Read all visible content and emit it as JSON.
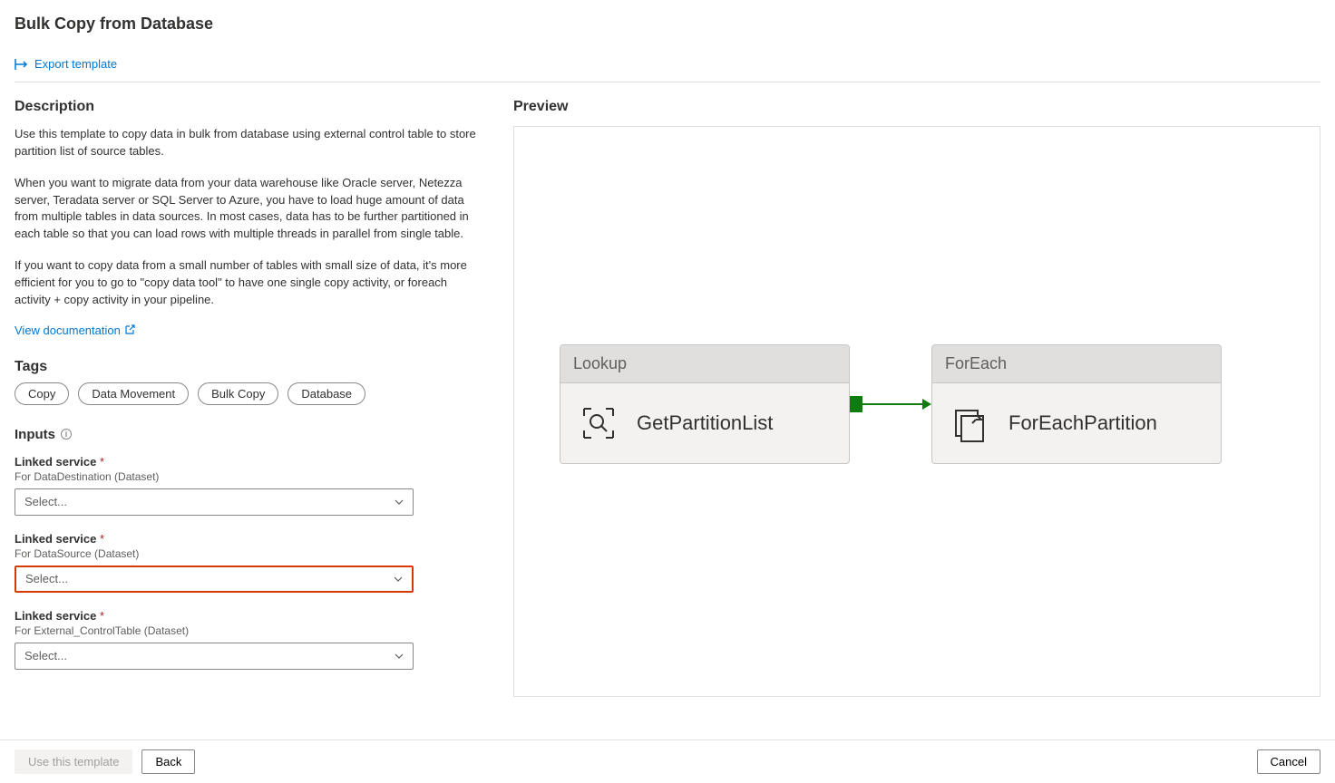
{
  "page": {
    "title": "Bulk Copy from Database",
    "export_template": "Export template"
  },
  "sections": {
    "description_title": "Description",
    "preview_title": "Preview",
    "tags_title": "Tags",
    "inputs_title": "Inputs"
  },
  "description": {
    "p1": "Use this template to copy data in bulk from database using external control table to store partition list of source tables.",
    "p2": "When you want to migrate data from your data warehouse like Oracle server, Netezza server, Teradata server or SQL Server to Azure, you have to load huge amount of data from multiple tables in data sources. In most cases, data has to be further partitioned in each table so that you can load rows with multiple threads in parallel from single table.",
    "p3": "If you want to copy data from a small number of tables with small size of data, it's more efficient for you to go to \"copy data tool\" to have one single copy activity, or foreach activity + copy activity in your pipeline.",
    "doc_link": "View documentation"
  },
  "tags": [
    "Copy",
    "Data Movement",
    "Bulk Copy",
    "Database"
  ],
  "inputs": [
    {
      "label": "Linked service",
      "sublabel": "For DataDestination (Dataset)",
      "placeholder": "Select...",
      "highlight": false
    },
    {
      "label": "Linked service",
      "sublabel": "For DataSource (Dataset)",
      "placeholder": "Select...",
      "highlight": true
    },
    {
      "label": "Linked service",
      "sublabel": "For External_ControlTable (Dataset)",
      "placeholder": "Select...",
      "highlight": false
    }
  ],
  "preview": {
    "activities": [
      {
        "type": "Lookup",
        "name": "GetPartitionList"
      },
      {
        "type": "ForEach",
        "name": "ForEachPartition"
      }
    ]
  },
  "footer": {
    "use_template": "Use this template",
    "back": "Back",
    "cancel": "Cancel"
  }
}
